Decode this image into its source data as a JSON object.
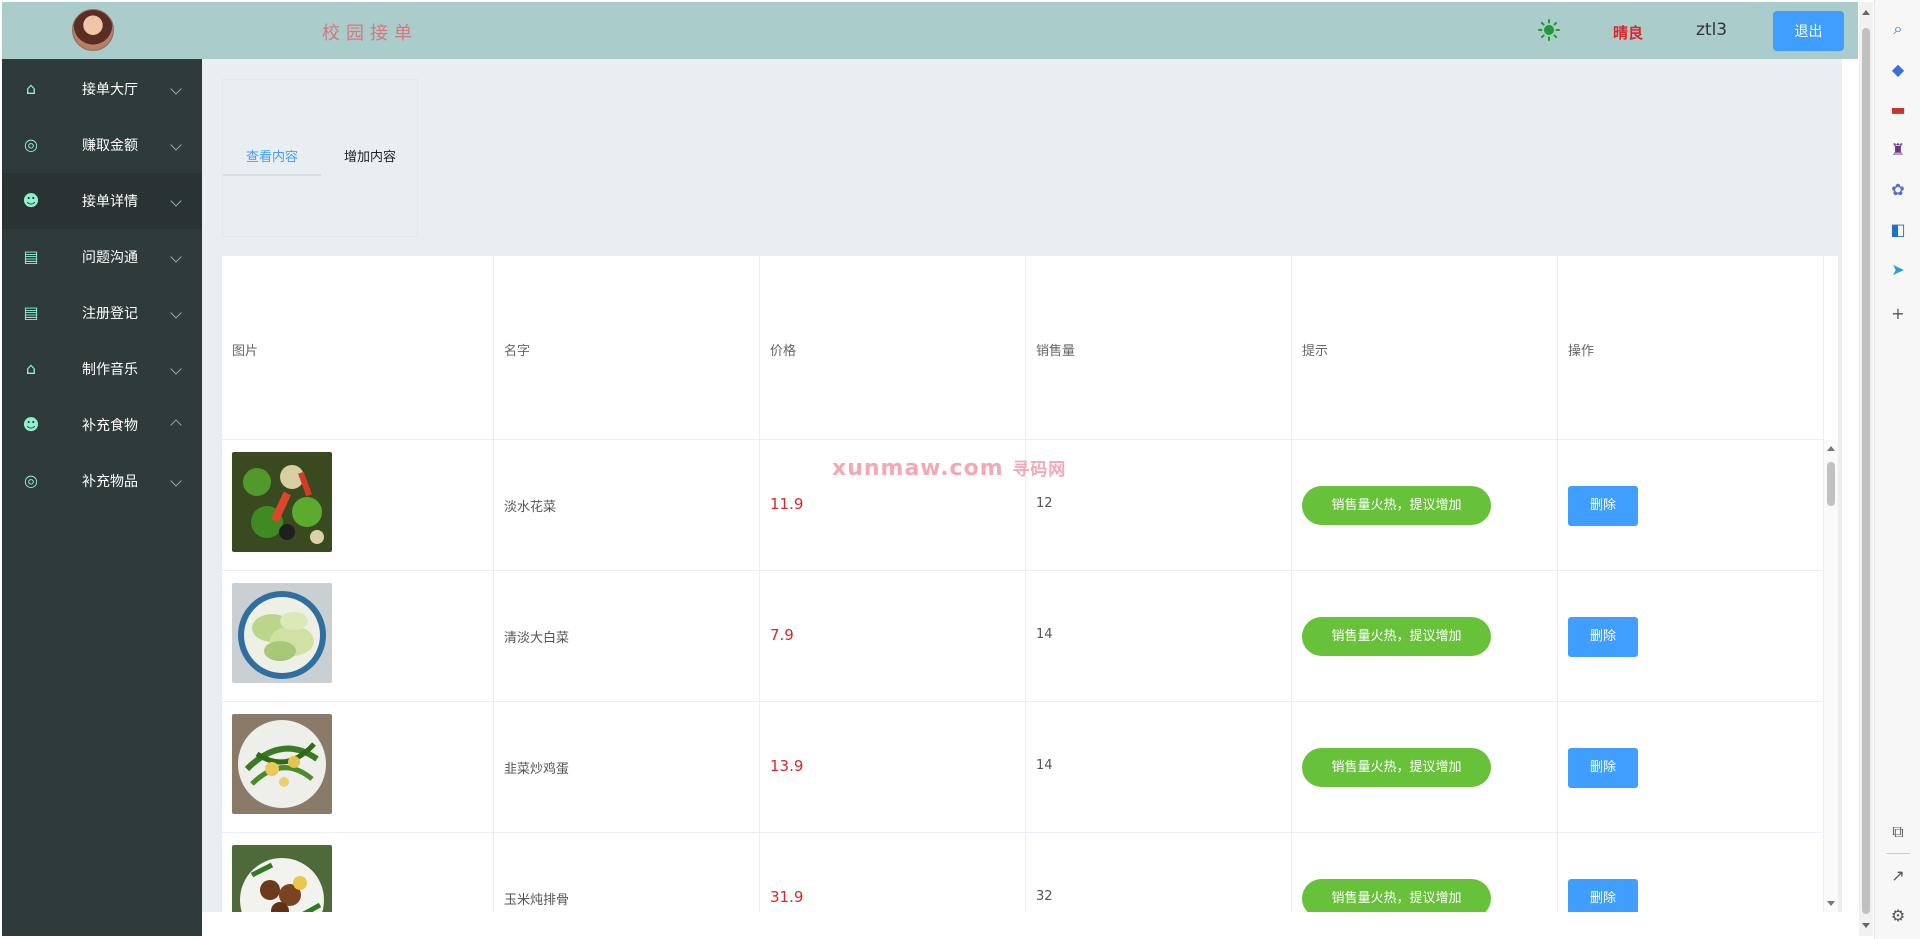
{
  "header": {
    "title": "校园接单",
    "weather": "晴良",
    "username": "ztl3",
    "logout_label": "退出",
    "colors": {
      "background": "#aacdcb",
      "title": "#d9767c",
      "weather": "#e0242a",
      "logout": "#409eff"
    }
  },
  "sidebar": {
    "background": "#2f3a3a",
    "items": [
      {
        "label": "接单大厅",
        "icon": "home-icon",
        "expanded": false
      },
      {
        "label": "赚取金额",
        "icon": "money-icon",
        "expanded": false
      },
      {
        "label": "接单详情",
        "icon": "bowl-icon",
        "expanded": false
      },
      {
        "label": "问题沟通",
        "icon": "chat-icon",
        "expanded": false
      },
      {
        "label": "注册登记",
        "icon": "register-icon",
        "expanded": false
      },
      {
        "label": "制作音乐",
        "icon": "home-icon",
        "expanded": false
      },
      {
        "label": "补充食物",
        "icon": "bowl-icon",
        "expanded": true
      },
      {
        "label": "补充物品",
        "icon": "money-icon",
        "expanded": false
      }
    ]
  },
  "tabs": [
    {
      "label": "查看内容",
      "active": true
    },
    {
      "label": "增加内容",
      "active": false
    }
  ],
  "table": {
    "columns": [
      "图片",
      "名字",
      "价格",
      "销售量",
      "提示",
      "操作"
    ],
    "rows": [
      {
        "image": "mixed-vegetables-photo",
        "name": "淡水花菜",
        "price": "11.9",
        "sales": "12",
        "hint": "销售量火热，提议增加",
        "action": "删除"
      },
      {
        "image": "cabbage-photo",
        "name": "清淡大白菜",
        "price": "7.9",
        "sales": "14",
        "hint": "销售量火热，提议增加",
        "action": "删除"
      },
      {
        "image": "chives-egg-photo",
        "name": "韭菜炒鸡蛋",
        "price": "13.9",
        "sales": "14",
        "hint": "销售量火热，提议增加",
        "action": "删除"
      },
      {
        "image": "corn-ribs-photo",
        "name": "玉米炖排骨",
        "price": "31.9",
        "sales": "32",
        "hint": "销售量火热，提议增加",
        "action": "删除"
      }
    ],
    "colors": {
      "price": "#e0242a",
      "hint": "#67c23a",
      "delete": "#409eff"
    }
  },
  "watermark": {
    "text": "xunmaw.com",
    "suffix": "寻码网"
  },
  "browser_side_panel": {
    "icons": [
      "search-icon",
      "tag-icon",
      "toolbox-icon",
      "chess-icon",
      "copilot-icon",
      "outlook-icon",
      "send-icon",
      "add-icon",
      "screenshot-icon",
      "external-link-icon",
      "settings-icon"
    ]
  }
}
